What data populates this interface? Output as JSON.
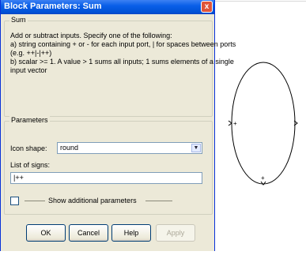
{
  "dialog": {
    "title": "Block Parameters: Sum",
    "close_glyph": "x"
  },
  "sum_group": {
    "legend": "Sum",
    "description_lines": [
      "Add or subtract inputs.  Specify one of the following:",
      "a) string containing + or - for each input port, | for spaces between ports",
      "(e.g. ++|-|++)",
      "b) scalar >= 1. A value > 1 sums all inputs; 1 sums elements of a single",
      "input vector"
    ]
  },
  "parameters_group": {
    "legend": "Parameters",
    "icon_shape_label": "Icon shape:",
    "icon_shape_value": "round",
    "signs_label": "List of signs:",
    "signs_value": "|++",
    "show_additional_label": "Show additional parameters",
    "show_additional_checked": false
  },
  "buttons": {
    "ok": "OK",
    "cancel": "Cancel",
    "help": "Help",
    "apply": "Apply"
  },
  "icons": {
    "dropdown": "chevron-down-icon",
    "close": "close-icon",
    "checkbox": "checkbox-icon"
  },
  "sum_block": {
    "shape": "round",
    "input_signs": [
      "+",
      "+"
    ]
  },
  "colors": {
    "titlebar": "#0a5fe8",
    "dialog_bg": "#ece9d8",
    "button_border": "#003c74"
  }
}
